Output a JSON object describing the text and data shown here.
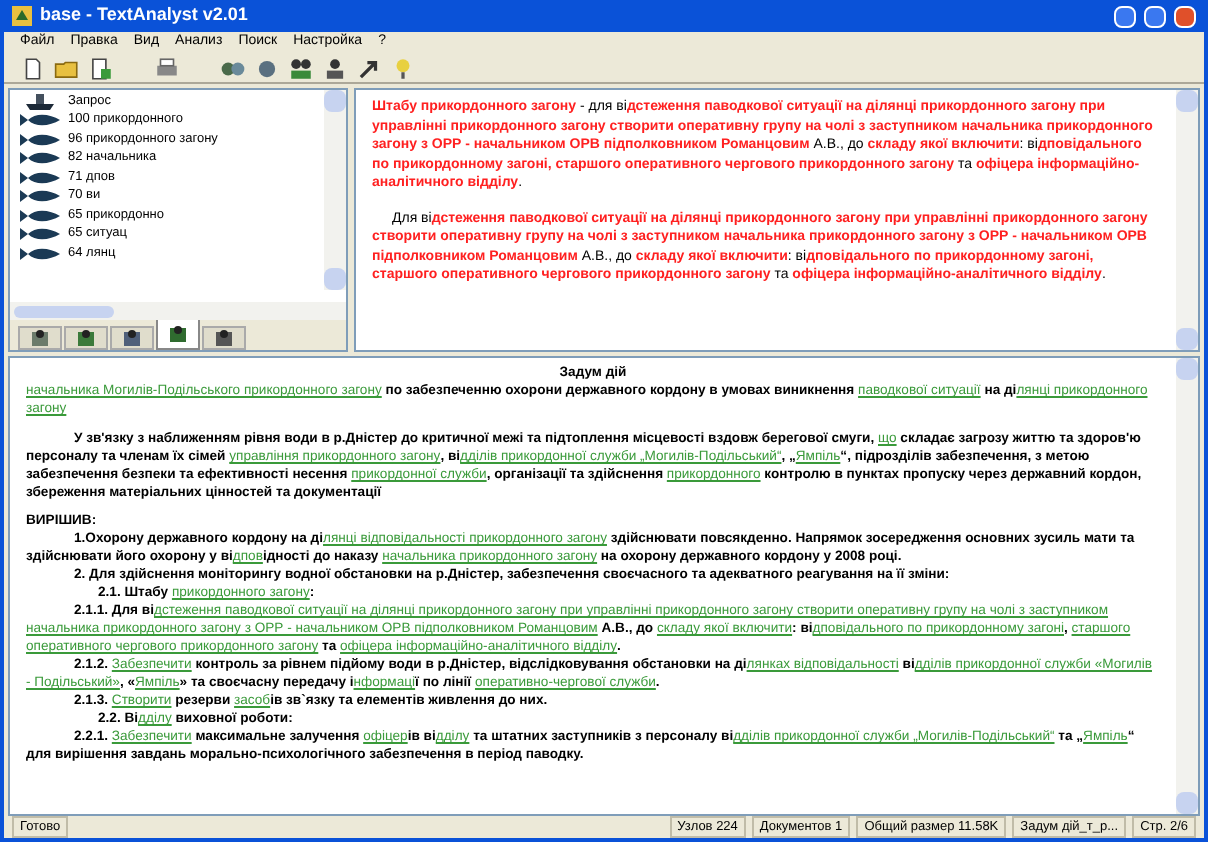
{
  "window": {
    "title": "base - TextAnalyst v2.01"
  },
  "menu": [
    "Файл",
    "Правка",
    "Вид",
    "Анализ",
    "Поиск",
    "Настройка",
    "?"
  ],
  "tree": {
    "items": [
      {
        "kind": "query",
        "label": "Запрос"
      },
      {
        "kind": "node",
        "label": "100 прикордонного"
      },
      {
        "kind": "node",
        "label": "96 прикордонного загону"
      },
      {
        "kind": "node",
        "label": "82 начальника"
      },
      {
        "kind": "node",
        "label": "71 дпов"
      },
      {
        "kind": "node",
        "label": "70 ви"
      },
      {
        "kind": "node",
        "label": "65 прикордонно"
      },
      {
        "kind": "node",
        "label": "65 ситуац"
      },
      {
        "kind": "node",
        "label": "64 лянц"
      }
    ],
    "tabs": [
      {
        "selected": false
      },
      {
        "selected": false
      },
      {
        "selected": false
      },
      {
        "selected": true
      },
      {
        "selected": false
      }
    ]
  },
  "summary": [
    [
      {
        "kind": "red",
        "text": "Штабу прикордонного загону"
      },
      {
        "kind": "black",
        "text": "  - для ві"
      },
      {
        "kind": "red",
        "text": "дстеження паводкової ситуації на ділянці прикордонного загону при управлінні прикордонного загону  створити оперативну групу на чолі з заступником начальника прикордонного загону з ОРР - начальником ОРВ підполковником Романцовим"
      },
      {
        "kind": "black",
        "text": " А.В., до "
      },
      {
        "kind": "red",
        "text": "складу якої включити"
      },
      {
        "kind": "black",
        "text": ": ві"
      },
      {
        "kind": "red",
        "text": "дповідального по прикордонному загоні, старшого оперативного чергового прикордонного загону"
      },
      {
        "kind": "black",
        "text": " та "
      },
      {
        "kind": "red",
        "text": "офіцера інформаційно-аналітичного відділу"
      },
      {
        "kind": "black",
        "text": "."
      }
    ],
    [
      {
        "kind": "black",
        "text": "Для ві"
      },
      {
        "kind": "red",
        "text": "дстеження паводкової ситуації на ділянці прикордонного загону при управлінні прикордонного загону  створити оперативну групу на чолі з заступником начальника прикордонного загону з ОРР - начальником ОРВ підполковником Романцовим"
      },
      {
        "kind": "black",
        "text": " А.В., до "
      },
      {
        "kind": "red",
        "text": "складу якої включити"
      },
      {
        "kind": "black",
        "text": ": ві"
      },
      {
        "kind": "red",
        "text": "дповідального по прикордонному загоні, старшого оперативного чергового прикордонного загону"
      },
      {
        "kind": "black",
        "text": " та "
      },
      {
        "kind": "red",
        "text": "офіцера інформаційно-аналітичного відділу"
      },
      {
        "kind": "black",
        "text": "."
      }
    ]
  ],
  "document": [
    {
      "kind": "title",
      "parts": [
        {
          "kind": "plain",
          "text": "Задум дій"
        }
      ]
    },
    {
      "kind": "lead",
      "parts": [
        {
          "kind": "link",
          "text": "начальника Могилів-Подільського прикордонного загону"
        },
        {
          "kind": "plain",
          "text": " по забезпеченню охорони державного кордону в умовах виникнення "
        },
        {
          "kind": "link",
          "text": "паводкової ситуації"
        },
        {
          "kind": "plain",
          "text": " на ді"
        },
        {
          "kind": "link",
          "text": "лянці прикордонного загону"
        }
      ]
    },
    {
      "kind": "para",
      "parts": [
        {
          "kind": "plain",
          "text": "У зв'язку з  наближенням рівня води в р.Дністер до критичної межі та  підтоплення  місцевості вздовж берегової смуги, "
        },
        {
          "kind": "link",
          "text": "що"
        },
        {
          "kind": "plain",
          "text": " складає загрозу життю та здоров'ю персоналу та членам їх сімей "
        },
        {
          "kind": "link",
          "text": "управління прикордонного загону"
        },
        {
          "kind": "plain",
          "text": ", ві"
        },
        {
          "kind": "link",
          "text": "дділів прикордонної служби „Могилів-Подільський“"
        },
        {
          "kind": "plain",
          "text": ", „"
        },
        {
          "kind": "link",
          "text": "Ямпіль"
        },
        {
          "kind": "plain",
          "text": "“, підрозділів забезпечення, з метою забезпечення безпеки та ефективності несення "
        },
        {
          "kind": "link",
          "text": "прикордонної служби"
        },
        {
          "kind": "plain",
          "text": ", організації та здійснення "
        },
        {
          "kind": "link",
          "text": "прикордонного"
        },
        {
          "kind": "plain",
          "text": " контролю в пунктах пропуску через державний кордон, збереження матеріальних цінностей та документації"
        }
      ]
    },
    {
      "kind": "heading",
      "parts": [
        {
          "kind": "plain",
          "text": "ВИРІШИВ:"
        }
      ]
    },
    {
      "kind": "point",
      "parts": [
        {
          "kind": "plain",
          "text": "1.Охорону державного кордону на ді"
        },
        {
          "kind": "link",
          "text": "лянці відповідальності прикордонного загону"
        },
        {
          "kind": "plain",
          "text": " здійснювати повсякденно. Напрямок зосередження основних зусиль мати та здійснювати його охорону  у ві"
        },
        {
          "kind": "link",
          "text": "дпов"
        },
        {
          "kind": "plain",
          "text": "ідності до   наказу "
        },
        {
          "kind": "link",
          "text": "начальника прикордонного загону"
        },
        {
          "kind": "plain",
          "text": " на охорону державного кордону у 2008 році."
        }
      ]
    },
    {
      "kind": "point",
      "parts": [
        {
          "kind": "plain",
          "text": "2. Для здійснення моніторингу водної обстановки на р.Дністер, забезпечення своєчасного та адекватного реагування на її зміни:"
        }
      ]
    },
    {
      "kind": "sub",
      "parts": [
        {
          "kind": "plain",
          "text": "2.1. Штабу "
        },
        {
          "kind": "link",
          "text": "прикордонного загону"
        },
        {
          "kind": "plain",
          "text": ":"
        }
      ]
    },
    {
      "kind": "point",
      "parts": [
        {
          "kind": "plain",
          "text": "2.1.1. Для ві"
        },
        {
          "kind": "link",
          "text": "дстеження паводкової ситуації на ділянці прикордонного загону при управлінні прикордонного загону  створити оперативну групу на чолі з заступником начальника прикордонного загону з ОРР - начальником ОРВ підполковником Романцовим"
        },
        {
          "kind": "plain",
          "text": " А.В., до "
        },
        {
          "kind": "link",
          "text": "складу якої включити"
        },
        {
          "kind": "plain",
          "text": ": ві"
        },
        {
          "kind": "link",
          "text": "дповідального по прикордонному загоні"
        },
        {
          "kind": "plain",
          "text": ", "
        },
        {
          "kind": "link",
          "text": "старшого оперативного чергового прикордонного загону"
        },
        {
          "kind": "plain",
          "text": " та "
        },
        {
          "kind": "link",
          "text": "офіцера інформаційно-аналітичного відділу"
        },
        {
          "kind": "plain",
          "text": "."
        }
      ]
    },
    {
      "kind": "point",
      "parts": [
        {
          "kind": "plain",
          "text": "2.1.2. "
        },
        {
          "kind": "link",
          "text": "Забезпечити"
        },
        {
          "kind": "plain",
          "text": " контроль за рівнем підйому води в р.Дністер, відслідковування обстановки на ді"
        },
        {
          "kind": "link",
          "text": "лянках відповідальності"
        },
        {
          "kind": "plain",
          "text": " ві"
        },
        {
          "kind": "link",
          "text": "дділів прикордонної служби «Могилів - Подільський»"
        },
        {
          "kind": "plain",
          "text": ", «"
        },
        {
          "kind": "link",
          "text": "Ямпіль"
        },
        {
          "kind": "plain",
          "text": "»  та своєчасну передачу і"
        },
        {
          "kind": "link",
          "text": "нформаці"
        },
        {
          "kind": "plain",
          "text": "ї по лінії "
        },
        {
          "kind": "link",
          "text": "оперативно-чергової служби"
        },
        {
          "kind": "plain",
          "text": "."
        }
      ]
    },
    {
      "kind": "point",
      "parts": [
        {
          "kind": "plain",
          "text": "2.1.3. "
        },
        {
          "kind": "link",
          "text": "Створити"
        },
        {
          "kind": "plain",
          "text": " резерви "
        },
        {
          "kind": "link",
          "text": "засоб"
        },
        {
          "kind": "plain",
          "text": "ів зв`язку та елементів живлення до них."
        }
      ]
    },
    {
      "kind": "sub",
      "parts": [
        {
          "kind": "plain",
          "text": "2.2. Ві"
        },
        {
          "kind": "link",
          "text": "дділу"
        },
        {
          "kind": "plain",
          "text": " виховної роботи:"
        }
      ]
    },
    {
      "kind": "point",
      "parts": [
        {
          "kind": "plain",
          "text": "2.2.1. "
        },
        {
          "kind": "link",
          "text": "Забезпечити"
        },
        {
          "kind": "plain",
          "text": " максимальне залучення "
        },
        {
          "kind": "link",
          "text": "офіцер"
        },
        {
          "kind": "plain",
          "text": "ів ві"
        },
        {
          "kind": "link",
          "text": "дділу"
        },
        {
          "kind": "plain",
          "text": " та штатних заступників з персоналу ві"
        },
        {
          "kind": "link",
          "text": "дділів прикордонної служби „Могилів-Подільський“"
        },
        {
          "kind": "plain",
          "text": " та „"
        },
        {
          "kind": "link",
          "text": "Ямпіль"
        },
        {
          "kind": "plain",
          "text": "“ для вирішення завдань морально-психологічного забезпечення в період паводку."
        }
      ]
    }
  ],
  "status_bar": [
    "Готово",
    "Узлов 224",
    "Документов 1",
    "Общий размер 11.58K",
    "Задум дій_т_р...",
    "Стр. 2/6"
  ]
}
